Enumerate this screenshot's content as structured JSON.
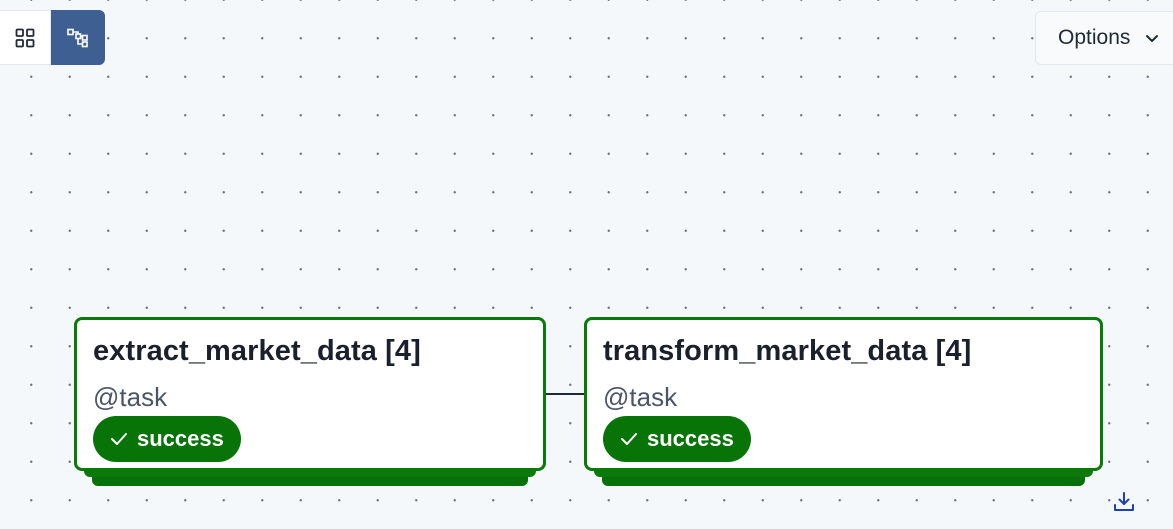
{
  "toolbar": {
    "view_buttons": [
      {
        "name": "grid-view",
        "icon": "grid-icon",
        "active": false
      },
      {
        "name": "graph-view",
        "icon": "graph-icon",
        "active": true
      }
    ],
    "options_label": "Options",
    "options_icon": "chevron-down-icon"
  },
  "colors": {
    "canvas_bg": "#f5f8fb",
    "success": "#087a08",
    "active_toggle": "#3d5f91",
    "edge": "#1f2937"
  },
  "nodes": [
    {
      "title": "extract_market_data [4]",
      "decorator": "@task",
      "status": "success",
      "status_icon": "check-icon"
    },
    {
      "title": "transform_market_data [4]",
      "decorator": "@task",
      "status": "success",
      "status_icon": "check-icon"
    }
  ],
  "footer": {
    "download_icon": "download-icon"
  }
}
